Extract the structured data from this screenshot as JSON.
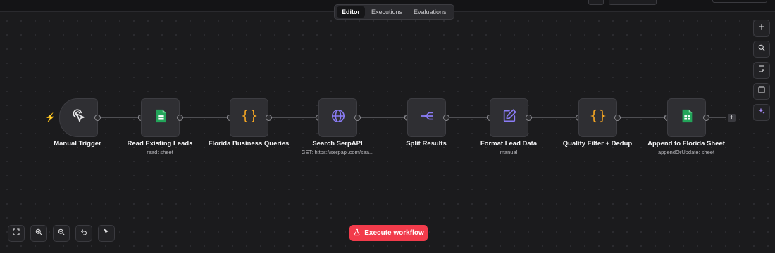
{
  "tabs": [
    {
      "label": "Editor",
      "active": true
    },
    {
      "label": "Executions",
      "active": false
    },
    {
      "label": "Evaluations",
      "active": false
    }
  ],
  "execute_button": {
    "label": "Execute workflow"
  },
  "nodes": [
    {
      "name": "Manual Trigger",
      "subtitle": "",
      "icon": "pointer-click-icon"
    },
    {
      "name": "Read Existing Leads",
      "subtitle": "read: sheet",
      "icon": "google-sheets-icon"
    },
    {
      "name": "Florida Business Queries",
      "subtitle": "",
      "icon": "code-braces-icon"
    },
    {
      "name": "Search SerpAPI",
      "subtitle": "GET: https://serpapi.com/sea...",
      "icon": "globe-icon"
    },
    {
      "name": "Split Results",
      "subtitle": "",
      "icon": "split-icon"
    },
    {
      "name": "Format Lead Data",
      "subtitle": "manual",
      "icon": "edit-pencil-icon"
    },
    {
      "name": "Quality Filter + Dedup",
      "subtitle": "",
      "icon": "code-braces-icon"
    },
    {
      "name": "Append to Florida Sheet",
      "subtitle": "appendOrUpdate: sheet",
      "icon": "google-sheets-icon"
    }
  ],
  "right_toolbar": [
    "zoom-in-plus-icon",
    "search-icon",
    "sticky-note-icon",
    "panel-toggle-icon",
    "ai-sparkle-icon"
  ],
  "bottom_toolbar": [
    "fit-view-icon",
    "zoom-in-icon",
    "zoom-out-icon",
    "undo-icon",
    "pointer-tool-icon"
  ],
  "colors": {
    "accent_red": "#f23b4b",
    "braces": "#f5a623",
    "purple": "#8b7cf6",
    "sheets_green": "#23a55a"
  }
}
